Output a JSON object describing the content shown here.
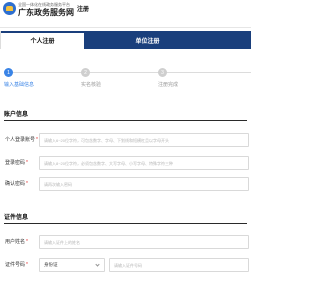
{
  "header": {
    "brand_subtitle": "全国一体化在线政务服务平台",
    "brand_name": "广东政务服务网",
    "page_title": "注册"
  },
  "tabs": [
    {
      "label": "个人注册",
      "active": true
    },
    {
      "label": "单位注册",
      "active": false
    }
  ],
  "steps": [
    {
      "number": "1",
      "label": "输入基础信息",
      "active": true
    },
    {
      "number": "2",
      "label": "实名核验",
      "active": false
    },
    {
      "number": "3",
      "label": "注册完成",
      "active": false
    }
  ],
  "account_section": {
    "title": "账户信息",
    "fields": [
      {
        "label": "个人登录账号",
        "required": true,
        "placeholder": "请输入6~20位字符，可包含数字、字母、下划线和短横杠且以字母开头"
      },
      {
        "label": "登录密码",
        "required": true,
        "placeholder": "请输入8~20位字符，必须包含数字、大写字母、小写字母、特殊字符三种"
      },
      {
        "label": "确认密码",
        "required": true,
        "placeholder": "请再次输入密码"
      }
    ]
  },
  "certificate_section": {
    "title": "证件信息",
    "fields": [
      {
        "label": "用户姓名",
        "required": true,
        "placeholder": "请输入证件上的姓名"
      },
      {
        "label": "证件号码",
        "required": true,
        "select_value": "身份证",
        "placeholder": "请输入证件号码"
      }
    ]
  },
  "colors": {
    "brand_navy": "#1a3f7c",
    "step_active": "#3a84e6",
    "required_mark": "#e02e2e"
  }
}
